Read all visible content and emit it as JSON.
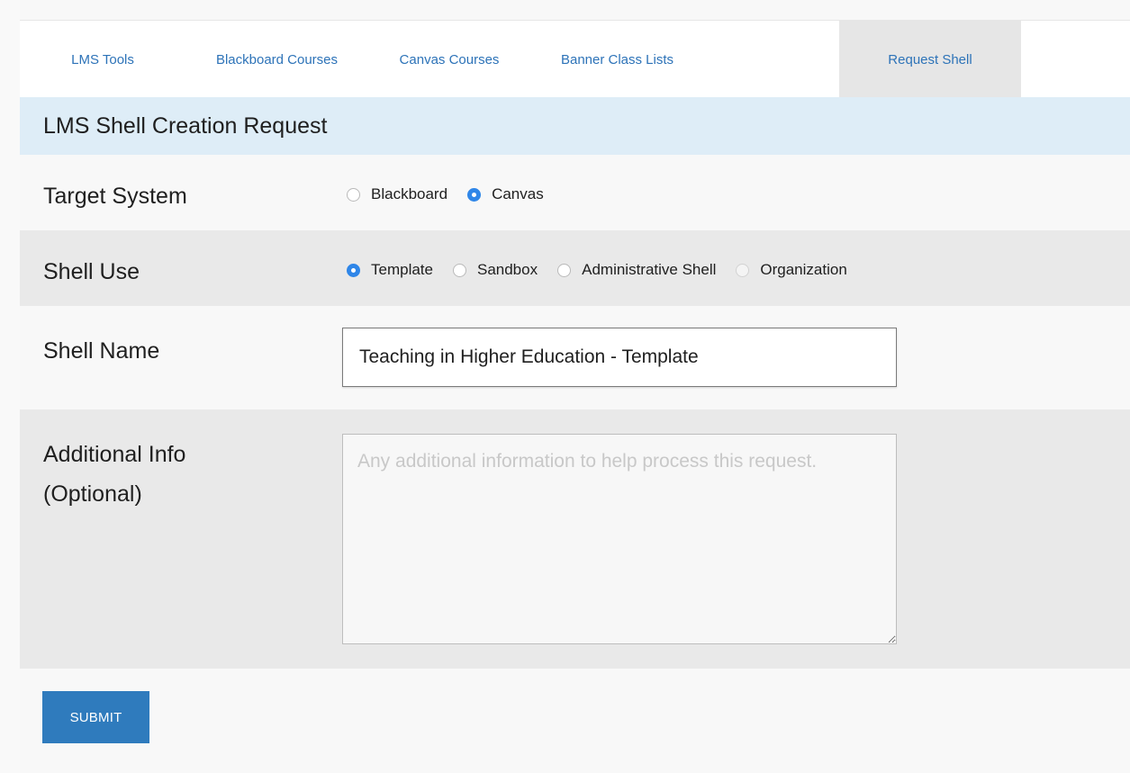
{
  "tabs": [
    {
      "label": "LMS Tools",
      "active": false
    },
    {
      "label": "Blackboard Courses",
      "active": false
    },
    {
      "label": "Canvas Courses",
      "active": false
    },
    {
      "label": "Banner Class Lists",
      "active": false
    },
    {
      "label": "Request Shell",
      "active": true
    }
  ],
  "header": {
    "title": "LMS Shell Creation Request"
  },
  "form": {
    "target_system": {
      "label": "Target System",
      "options": [
        {
          "label": "Blackboard",
          "checked": false
        },
        {
          "label": "Canvas",
          "checked": true
        }
      ]
    },
    "shell_use": {
      "label": "Shell Use",
      "options": [
        {
          "label": "Template",
          "checked": true
        },
        {
          "label": "Sandbox",
          "checked": false
        },
        {
          "label": "Administrative Shell",
          "checked": false
        },
        {
          "label": "Organization",
          "checked": false,
          "disabled": true
        }
      ]
    },
    "shell_name": {
      "label": "Shell Name",
      "value": "Teaching in Higher Education - Template"
    },
    "additional_info": {
      "label_line1": "Additional Info",
      "label_line2": "(Optional)",
      "placeholder": "Any additional information to help process this request.",
      "value": ""
    },
    "submit_label": "SUBMIT"
  },
  "colors": {
    "link": "#2d73b8",
    "header_band": "#deedf7",
    "radio_checked": "#2f86e8",
    "submit_button": "#2f7bbd"
  }
}
